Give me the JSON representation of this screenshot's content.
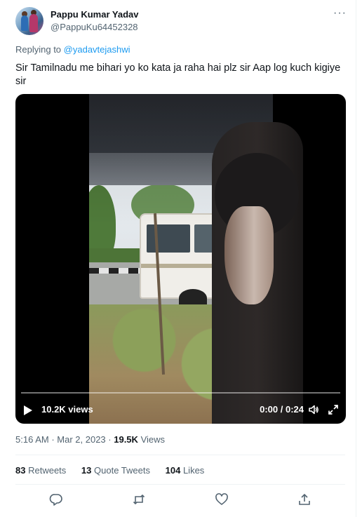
{
  "user": {
    "name": "Pappu Kumar Yadav",
    "handle": "@PappuKu64452328"
  },
  "reply": {
    "prefix": "Replying to",
    "to": "@yadavtejashwi"
  },
  "tweet": {
    "text": "Sir Tamilnadu me bihari yo ko kata ja raha hai plz sir Aap log kuch kigiye sir"
  },
  "video": {
    "views": "10.2K views",
    "time": "0:00 / 0:24",
    "progress": 0.0
  },
  "meta": {
    "time": "5:16 AM",
    "date": "Mar 2, 2023",
    "views_count": "19.5K",
    "views_label": "Views"
  },
  "stats": {
    "retweets_count": "83",
    "retweets_label": "Retweets",
    "quotes_count": "13",
    "quotes_label": "Quote Tweets",
    "likes_count": "104",
    "likes_label": "Likes"
  },
  "icons": {
    "more": "more-dots-icon",
    "reply": "reply-icon",
    "retweet": "retweet-icon",
    "like": "heart-icon",
    "share": "share-icon",
    "play": "play-icon",
    "volume": "volume-icon",
    "fullscreen": "fullscreen-icon"
  },
  "colors": {
    "accent": "#1d9bf0",
    "muted": "#536471",
    "text": "#0f1419"
  }
}
